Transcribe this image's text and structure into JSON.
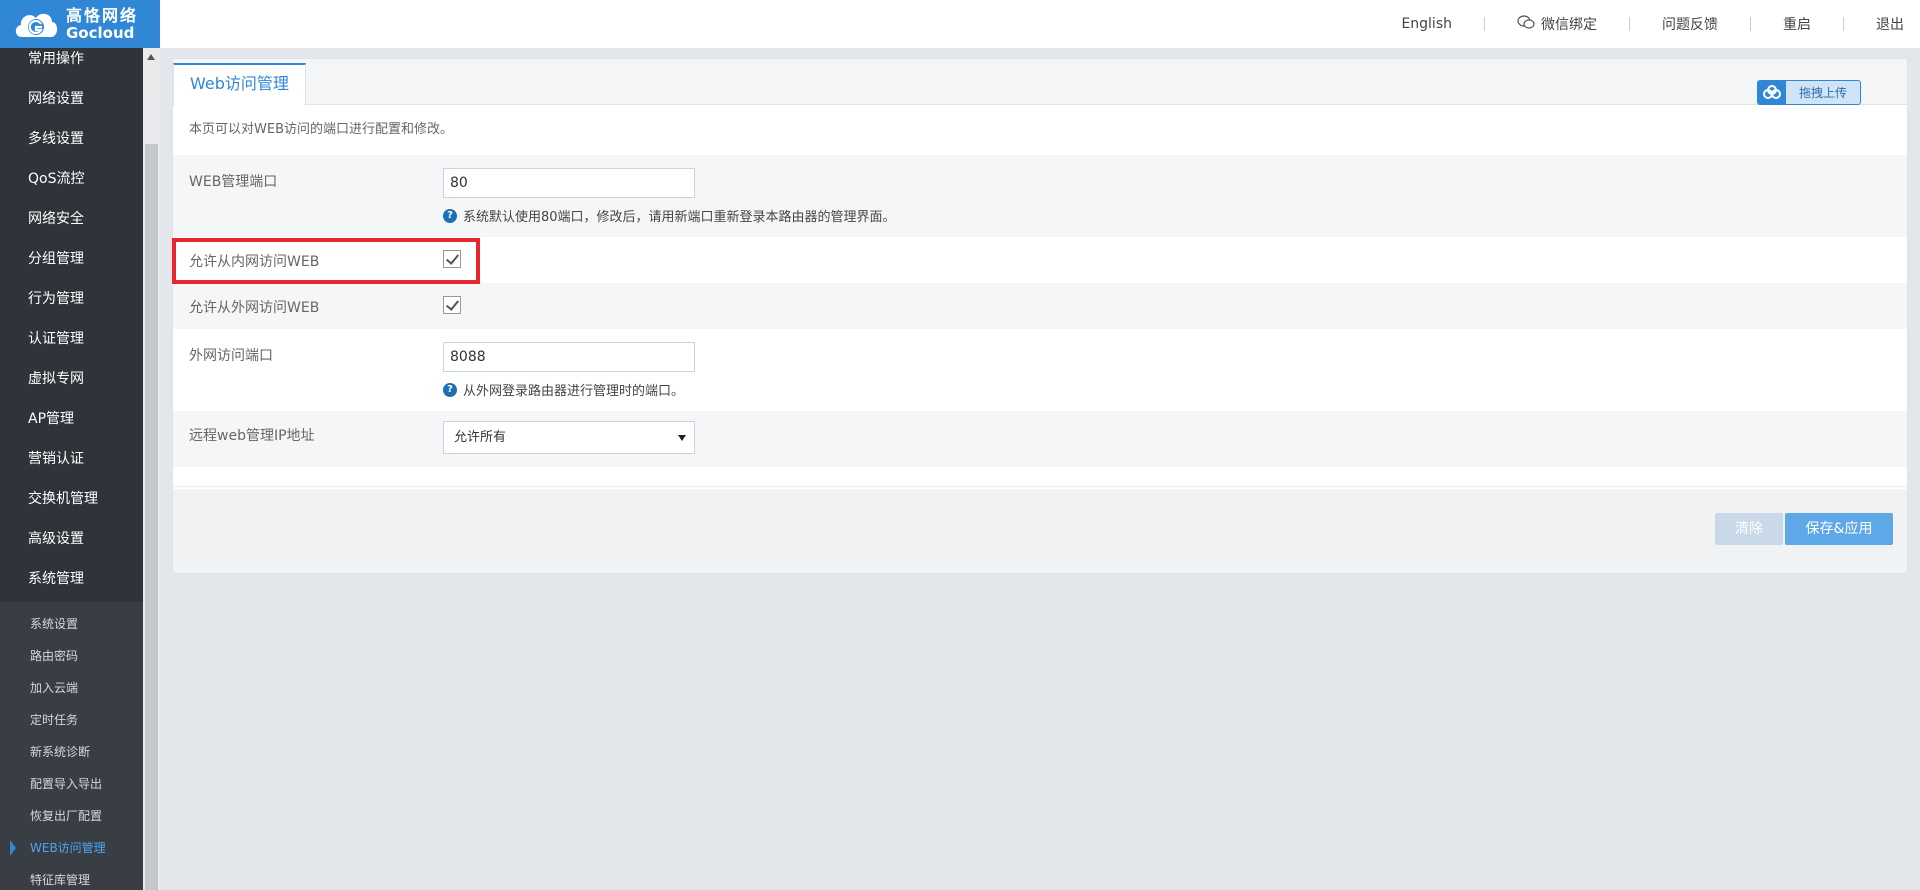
{
  "logo": {
    "cn": "高恪网络",
    "en": "Gocloud"
  },
  "topnav": {
    "english": "English",
    "wechat": "微信绑定",
    "feedback": "问题反馈",
    "reboot": "重启",
    "logout": "退出"
  },
  "sidebar": {
    "items": [
      {
        "label": "常用操作"
      },
      {
        "label": "网络设置"
      },
      {
        "label": "多线设置"
      },
      {
        "label": "QoS流控"
      },
      {
        "label": "网络安全"
      },
      {
        "label": "分组管理"
      },
      {
        "label": "行为管理"
      },
      {
        "label": "认证管理"
      },
      {
        "label": "虚拟专网"
      },
      {
        "label": "AP管理"
      },
      {
        "label": "营销认证"
      },
      {
        "label": "交换机管理"
      },
      {
        "label": "高级设置"
      },
      {
        "label": "系统管理"
      }
    ],
    "sub_items": [
      {
        "label": "系统设置"
      },
      {
        "label": "路由密码"
      },
      {
        "label": "加入云端"
      },
      {
        "label": "定时任务"
      },
      {
        "label": "新系统诊断"
      },
      {
        "label": "配置导入导出"
      },
      {
        "label": "恢复出厂配置"
      },
      {
        "label": "WEB访问管理"
      },
      {
        "label": "特征库管理"
      }
    ],
    "active_sub_item": "WEB访问管理"
  },
  "main": {
    "tab_label": "Web访问管理",
    "upload_label": "拖拽上传",
    "description": "本页可以对WEB访问的端口进行配置和修改。",
    "web_port": {
      "label": "WEB管理端口",
      "value": "80",
      "hint": "系统默认使用80端口，修改后，请用新端口重新登录本路由器的管理界面。"
    },
    "allow_lan": {
      "label": "允许从内网访问WEB",
      "checked": true
    },
    "allow_wan": {
      "label": "允许从外网访问WEB",
      "checked": true
    },
    "wan_port": {
      "label": "外网访问端口",
      "value": "8088",
      "hint": "从外网登录路由器进行管理时的端口。"
    },
    "remote_ip": {
      "label": "远程web管理IP地址",
      "selected": "允许所有"
    },
    "buttons": {
      "clear": "清除",
      "save": "保存&应用"
    }
  },
  "colors": {
    "brand": "#2f87d6",
    "highlight": "#e8262b",
    "sidebar_bg": "#2f333a"
  }
}
